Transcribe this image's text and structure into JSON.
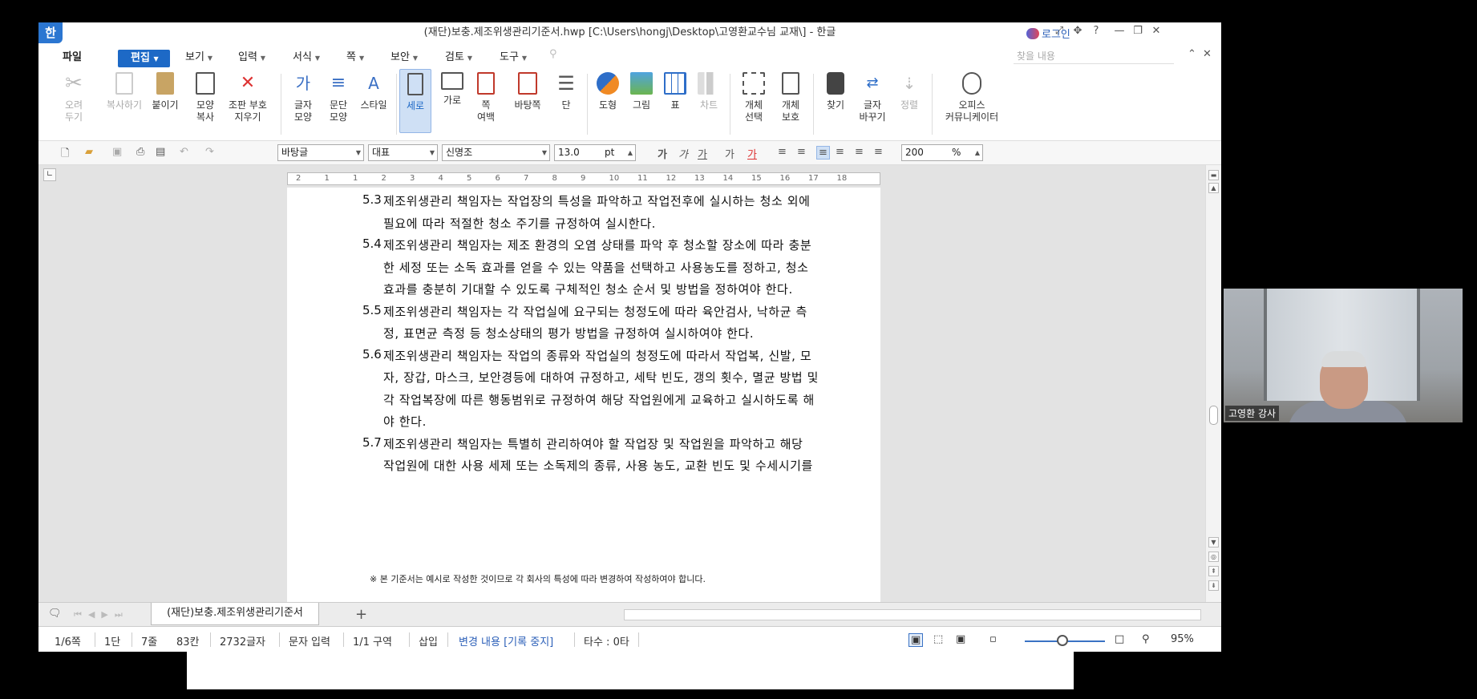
{
  "window": {
    "logo": "한",
    "title": "(재단)보충.제조위생관리기준서.hwp [C:\\Users\\hongj\\Desktop\\고영환교수님 교재\\] - 한글",
    "login": "로그인"
  },
  "menu": {
    "file": "파일",
    "active": "편집",
    "items": [
      "보기",
      "입력",
      "서식",
      "쪽",
      "보안",
      "검토",
      "도구"
    ],
    "find_placeholder": "찾을 내용"
  },
  "ribbon": {
    "cut": "오려\n두기",
    "copy": "복사하기",
    "paste": "붙이기",
    "format_copy": "모양\n복사",
    "clear_marks": "조판 부호\n지우기",
    "char_shape": "글자\n모양",
    "para_shape": "문단\n모양",
    "style": "스타일",
    "portrait": "세로",
    "landscape": "가로",
    "margins": "쪽\n여백",
    "background": "바탕쪽",
    "columns": "단",
    "shape": "도형",
    "picture": "그림",
    "table": "표",
    "chart": "차트",
    "select_obj": "개체\n선택",
    "protect_obj": "개체\n보호",
    "find": "찾기",
    "replace": "글자\n바꾸기",
    "sort": "정렬",
    "office": "오피스\n커뮤니케이터"
  },
  "format_bar": {
    "style": "바탕글",
    "lang": "대표",
    "font": "신명조",
    "size": "13.0",
    "unit": "pt",
    "zoom": "200",
    "zoom_unit": "%"
  },
  "ruler_numbers": [
    "2",
    "1",
    "1",
    "2",
    "3",
    "4",
    "5",
    "6",
    "7",
    "8",
    "9",
    "10",
    "11",
    "12",
    "13",
    "14",
    "15",
    "16",
    "17",
    "18"
  ],
  "document": {
    "paragraphs": [
      {
        "num": "5.3",
        "lines": [
          "제조위생관리 책임자는 작업장의 특성을 파악하고 작업전후에 실시하는 청소 외에",
          "필요에 따라 적절한 청소 주기를 규정하여 실시한다."
        ]
      },
      {
        "num": "5.4",
        "lines": [
          "제조위생관리 책임자는 제조 환경의 오염 상태를 파악 후 청소할 장소에 따라 충분",
          "한 세정 또는 소독 효과를 얻을 수 있는 약품을 선택하고 사용농도를 정하고, 청소",
          "효과를 충분히 기대할  수 있도록 구체적인 청소 순서 및 방법을 정하여야 한다."
        ]
      },
      {
        "num": "5.5",
        "lines": [
          "제조위생관리 책임자는 각 작업실에 요구되는 청정도에 따라 육안검사, 낙하균 측",
          "정, 표면균 측정 등 청소상태의 평가 방법을 규정하여 실시하여야 한다."
        ]
      },
      {
        "num": "5.6",
        "lines": [
          "제조위생관리 책임자는 작업의 종류와 작업실의 청정도에 따라서 작업복, 신발, 모",
          "자, 장갑, 마스크, 보안경등에 대하여 규정하고, 세탁 빈도, 갱의 횟수, 멸균 방법 및",
          "각 작업복장에 따른 행동범위로 규정하여 해당 작업원에게 교육하고 실시하도록 해",
          "야 한다."
        ]
      },
      {
        "num": "5.7",
        "lines": [
          "제조위생관리 책임자는 특별히 관리하여야 할 작업장 및 작업원을 파악하고 해당",
          "작업원에 대한 사용 세제 또는 소독제의 종류, 사용 농도, 교환 빈도 및 수세시기를"
        ]
      }
    ],
    "footnote": "※ 본 기준서는 예시로 작성한 것이므로 각 회사의 특성에 따라 변경하여 작성하여야 합니다."
  },
  "tabs": {
    "doc_tab": "(재단)보충.제조위생관리기준서",
    "add": "+"
  },
  "status": {
    "page": "1/6쪽",
    "col": "1단",
    "line": "7줄",
    "char_pos": "83칸",
    "char_count": "2732글자",
    "mode": "문자 입력",
    "section": "1/1 구역",
    "insert": "삽입",
    "track": "변경 내용 [기록 중지]",
    "strokes": "타수 : 0타",
    "zoom": "95%"
  },
  "webcam": {
    "name": "고영환 강사"
  }
}
